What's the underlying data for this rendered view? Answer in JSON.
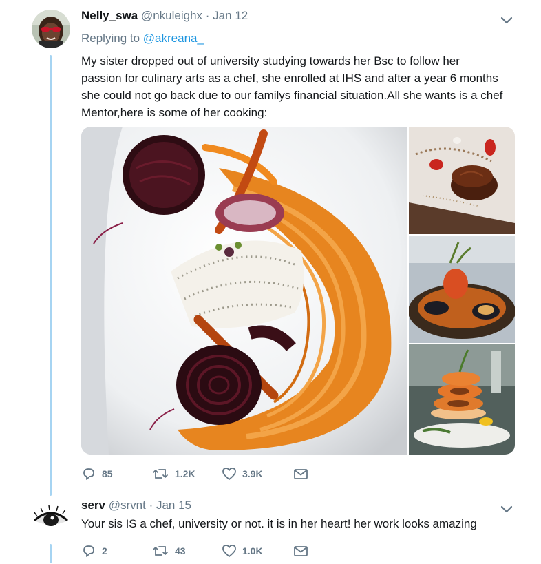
{
  "tweet": {
    "author_name": "Nelly_swa",
    "handle": "@nkuleighx",
    "date": "· Jan 12",
    "replying_prefix": "Replying to",
    "replying_to": "@akreana_",
    "text_lines": [
      "My sister dropped out of university studying towards her Bsc to follow her",
      "passion for culinary arts as a chef, she enrolled at IHS and after a year 6 months",
      "she could not go back due to our familys financial situation.All she wants is a chef",
      "Mentor,here is some of her cooking:"
    ],
    "replies": "85",
    "retweets": "1.2K",
    "likes": "3.9K"
  },
  "reply": {
    "author_name": "serv",
    "handle": "@srvnt",
    "date": "· Jan 15",
    "text": "Your sis IS a chef, university or not. it is in her heart! her work looks amazing",
    "replies": "2",
    "retweets": "43",
    "likes": "1.0K"
  },
  "colors": {
    "accent": "#1b95e0",
    "thread_line": "#a6d4f2",
    "muted_text": "#657786",
    "like_icon": "#657786"
  },
  "icons": [
    "reply-icon",
    "retweet-icon",
    "like-icon",
    "message-icon",
    "chevron-down-icon"
  ]
}
